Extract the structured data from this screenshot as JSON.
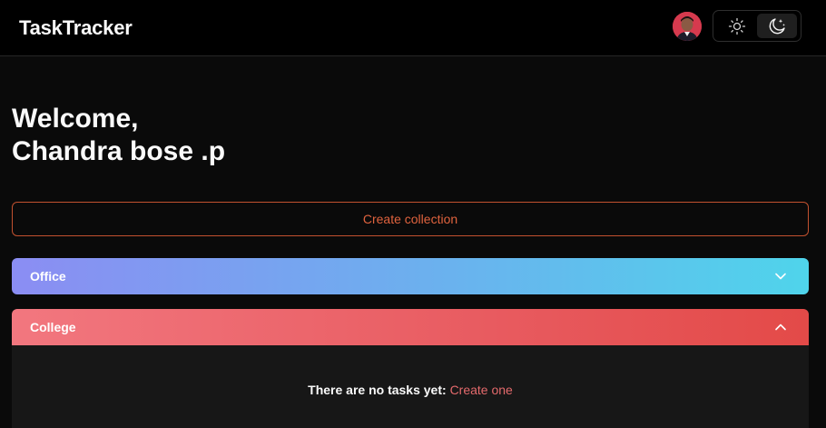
{
  "navbar": {
    "brand": "TaskTracker",
    "avatar_icon": "user-avatar",
    "theme": {
      "light_icon": "sun-icon",
      "dark_icon": "moon-stars-icon",
      "active": "dark"
    }
  },
  "welcome": {
    "line1": "Welcome,",
    "line2": "Chandra bose .p"
  },
  "create_collection_label": "Create collection",
  "collections": [
    {
      "name": "Office",
      "expanded": false,
      "gradient": [
        "#8b8df3",
        "#4fd4eb"
      ]
    },
    {
      "name": "College",
      "expanded": true,
      "gradient": [
        "#f2777f",
        "#e34a48"
      ]
    }
  ],
  "empty_state": {
    "text": "There are no tasks yet:",
    "link": "Create one"
  },
  "colors": {
    "accent": "#e0633e",
    "background": "#0a0a0a",
    "navbar": "#000000",
    "link": "#e46a6c"
  }
}
